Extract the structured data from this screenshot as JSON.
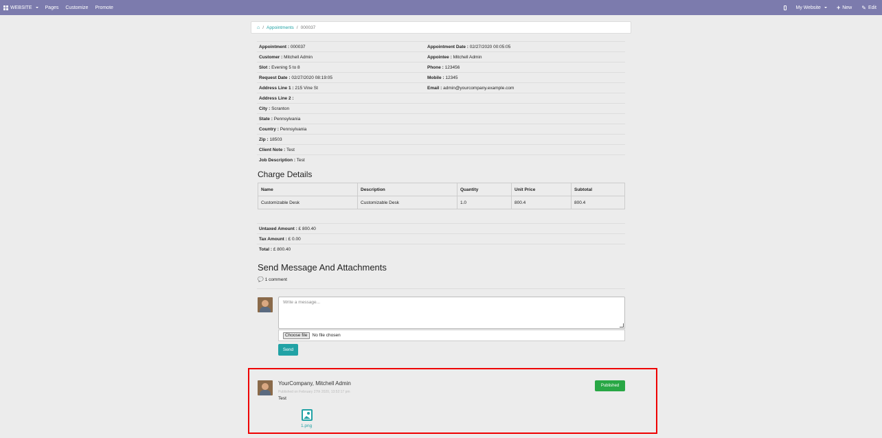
{
  "topbar": {
    "website": "WEBSITE",
    "pages": "Pages",
    "customize": "Customize",
    "promote": "Promote",
    "my_website": "My Website",
    "new": "New",
    "edit": "Edit"
  },
  "breadcrumb": {
    "appointments": "Appointments",
    "current": "000037"
  },
  "info": {
    "left": [
      {
        "label": "Appointment :",
        "value": "000037"
      },
      {
        "label": "Customer :",
        "value": "Mitchell Admin"
      },
      {
        "label": "Slot :",
        "value": "Evening 5 to 8"
      },
      {
        "label": "Request Date :",
        "value": "02/27/2020 08:19:05"
      },
      {
        "label": "Address Line 1 :",
        "value": "215 Vine St"
      },
      {
        "label": "Address Line 2 :",
        "value": ""
      },
      {
        "label": "City :",
        "value": "Scranton"
      },
      {
        "label": "State :",
        "value": "Pennsylvania"
      },
      {
        "label": "Country :",
        "value": "Pennsylvania"
      },
      {
        "label": "Zip :",
        "value": "18503"
      },
      {
        "label": "Client Note :",
        "value": "Test"
      },
      {
        "label": "Job Description :",
        "value": "Test"
      }
    ],
    "right": [
      {
        "label": "Appointment Date :",
        "value": "02/27/2020 00:05:05"
      },
      {
        "label": "Appointee :",
        "value": "Mitchell Admin"
      },
      {
        "label": "Phone :",
        "value": "123456"
      },
      {
        "label": "Mobile :",
        "value": "12345"
      },
      {
        "label": "Email :",
        "value": "admin@yourcompany.example.com"
      }
    ]
  },
  "charge": {
    "title": "Charge Details",
    "headers": [
      "Name",
      "Description",
      "Quantity",
      "Unit Price",
      "Subtotal"
    ],
    "rows": [
      [
        "Customizable Desk",
        "Customizable Desk",
        "1.0",
        "800.4",
        "800.4"
      ]
    ]
  },
  "totals": {
    "untaxed_label": "Untaxed Amount :",
    "untaxed_value": "£ 800.40",
    "tax_label": "Tax Amount :",
    "tax_value": "£ 0.00",
    "total_label": "Total :",
    "total_value": "£ 800.40"
  },
  "messages": {
    "title": "Send Message And Attachments",
    "comment_count": "1 comment",
    "placeholder": "Write a message...",
    "choose_file": "Choose file",
    "no_file": "No file chosen",
    "send": "Send"
  },
  "post": {
    "author": "YourCompany, Mitchell Admin",
    "published_on": "Published on February 27th 2020, 13:52:17 pm",
    "text": "Test",
    "badge": "Published",
    "attachment": "1.png"
  }
}
